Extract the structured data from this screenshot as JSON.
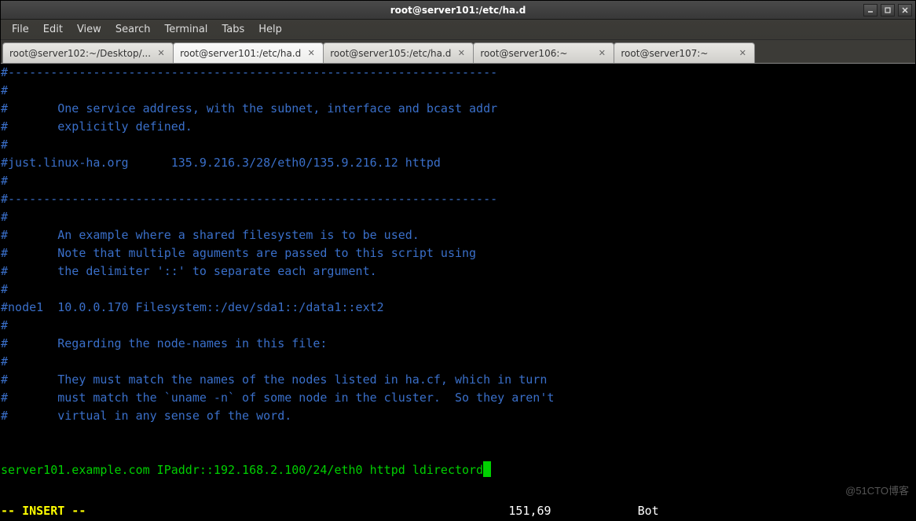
{
  "window": {
    "title": "root@server101:/etc/ha.d"
  },
  "menu": {
    "items": [
      "File",
      "Edit",
      "View",
      "Search",
      "Terminal",
      "Tabs",
      "Help"
    ]
  },
  "tabs": [
    {
      "label": "root@server102:~/Desktop/...",
      "active": false
    },
    {
      "label": "root@server101:/etc/ha.d",
      "active": true
    },
    {
      "label": "root@server105:/etc/ha.d",
      "active": false
    },
    {
      "label": "root@server106:~",
      "active": false
    },
    {
      "label": "root@server107:~",
      "active": false
    }
  ],
  "editor": {
    "lines": [
      "#---------------------------------------------------------------------",
      "#",
      "#       One service address, with the subnet, interface and bcast addr",
      "#       explicitly defined.",
      "#",
      "#just.linux-ha.org      135.9.216.3/28/eth0/135.9.216.12 httpd",
      "#",
      "#---------------------------------------------------------------------",
      "#",
      "#       An example where a shared filesystem is to be used.",
      "#       Note that multiple aguments are passed to this script using",
      "#       the delimiter '::' to separate each argument.",
      "#",
      "#node1  10.0.0.170 Filesystem::/dev/sda1::/data1::ext2",
      "#",
      "#       Regarding the node-names in this file:",
      "#",
      "#       They must match the names of the nodes listed in ha.cf, which in turn",
      "#       must match the `uname -n` of some node in the cluster.  So they aren't",
      "#       virtual in any sense of the word.",
      "",
      ""
    ],
    "active_line": "server101.example.com IPaddr::192.168.2.100/24/eth0 httpd ldirectord",
    "mode": "-- INSERT --",
    "position": "151,69",
    "scroll": "Bot"
  },
  "watermark": "@51CTO博客"
}
